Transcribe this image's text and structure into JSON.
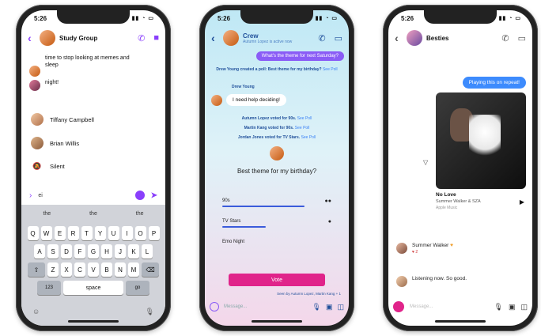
{
  "phone1": {
    "time": "5:26",
    "title": "Study Group",
    "message_1": "time to stop looking at memes and sleep",
    "message_2": "night!",
    "members": [
      {
        "name": "Tiffany Campbell"
      },
      {
        "name": "Brian Willis"
      },
      {
        "name": "Silent"
      }
    ],
    "input_value": "ei",
    "suggestions": [
      "the",
      "the",
      "the"
    ],
    "keys_row1": [
      "Q",
      "W",
      "E",
      "R",
      "T",
      "Y",
      "U",
      "I",
      "O",
      "P"
    ],
    "keys_row2": [
      "A",
      "S",
      "D",
      "F",
      "G",
      "H",
      "J",
      "K",
      "L"
    ],
    "keys_row3": [
      "Z",
      "X",
      "C",
      "V",
      "B",
      "N",
      "M"
    ],
    "key_123": "123",
    "key_space": "space",
    "key_go": "go"
  },
  "phone2": {
    "time": "5:26",
    "title": "Crew",
    "subtitle": "Autumn Lopez is active now",
    "bubble_top": "What's the theme for next Saturday?",
    "sys_1_bold": "Drew Young created a poll: Best theme for my birthday?",
    "sys_1_link": "See Poll",
    "sender": "Drew Young",
    "bubble_help": "I need help deciding!",
    "votes": [
      {
        "text": "Autumn Lopez voted for 90s.",
        "link": "See Poll"
      },
      {
        "text": "Martin Kang voted for 90s.",
        "link": "See Poll"
      },
      {
        "text": "Jordan Jones voted for TV Stars.",
        "link": "See Poll"
      }
    ],
    "poll_question": "Best theme for my birthday?",
    "poll_options": [
      {
        "label": "90s",
        "fill": 0.75
      },
      {
        "label": "TV Stars",
        "fill": 0.4
      },
      {
        "label": "Emo Night",
        "fill": 0
      }
    ],
    "vote_label": "Vote",
    "seen_by": "Seen by Autumn Lopez, Martin Kang + 1",
    "input_placeholder": "Message..."
  },
  "phone3": {
    "time": "5:26",
    "title": "Besties",
    "bubble": "Playing this on repeat!",
    "song_title": "No Love",
    "song_artist": "Summer Walker & SZA",
    "song_source": "Apple Music",
    "msg_1_sender": "Summer Walker",
    "msg_1_reaction": "♥ 2",
    "msg_2": "Listening now. So good.",
    "input_placeholder": "Message..."
  }
}
